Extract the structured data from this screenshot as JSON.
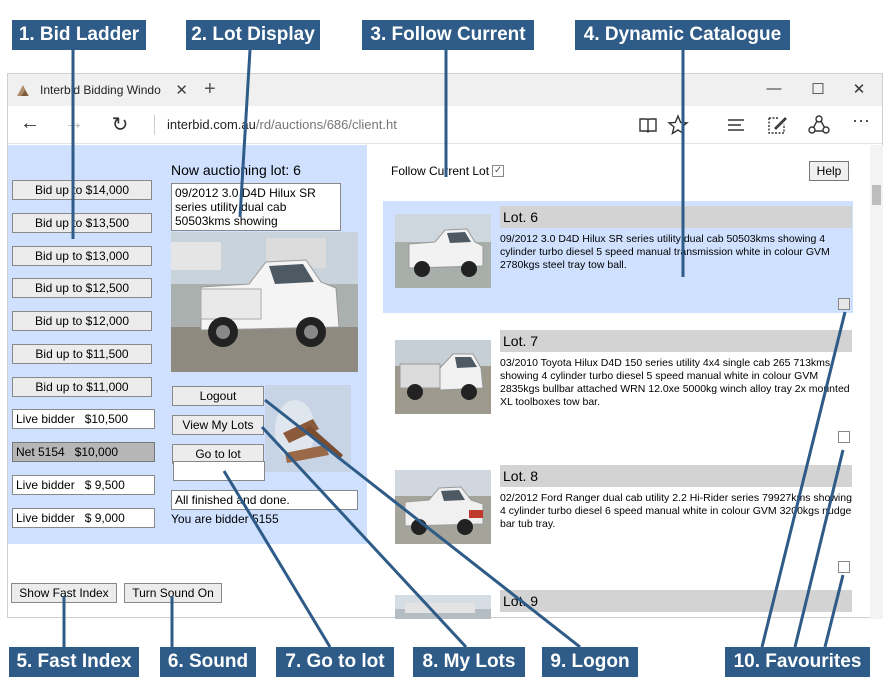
{
  "callouts": [
    {
      "label": "1. Bid Ladder"
    },
    {
      "label": "2. Lot Display"
    },
    {
      "label": "3. Follow Current"
    },
    {
      "label": "4. Dynamic Catalogue"
    },
    {
      "label": "5. Fast Index"
    },
    {
      "label": "6. Sound"
    },
    {
      "label": "7. Go to lot"
    },
    {
      "label": "8. My Lots"
    },
    {
      "label": "9. Logon"
    },
    {
      "label": "10. Favourites"
    }
  ],
  "browser": {
    "tab_title": "Interbid Bidding Windo",
    "tab_close": "✕",
    "new_tab": "+",
    "minimize": "—",
    "maximize": "☐",
    "close": "✕",
    "back": "←",
    "forward": "→",
    "refresh": "↻",
    "url_host": "interbid.com.au",
    "url_path": "/rd/auctions/686/client.ht",
    "more": "···"
  },
  "bid_ladder": {
    "buttons": [
      "Bid up to $14,000",
      "Bid up to $13,500",
      "Bid up to $13,000",
      "Bid up to $12,500",
      "Bid up to $12,000",
      "Bid up to $11,500",
      "Bid up to $11,000"
    ],
    "bids": [
      {
        "text": "Live bidder   $10,500",
        "net": false
      },
      {
        "text": "Net 5154   $10,000",
        "net": true
      },
      {
        "text": "Live bidder   $ 9,500",
        "net": false
      },
      {
        "text": "Live bidder   $ 9,000",
        "net": false
      }
    ]
  },
  "lot_display": {
    "now_auctioning": "Now auctioning lot: 6",
    "description": "09/2012 3.0 D4D Hilux SR series utility dual cab 50503kms showing",
    "logout": "Logout",
    "view_my_lots": "View My Lots",
    "go_to_lot": "Go to lot",
    "goto_value": "",
    "status": "All finished and done.",
    "bidder": "You are bidder 5155"
  },
  "bottom_buttons": {
    "fast_index": "Show Fast Index",
    "sound": "Turn Sound On"
  },
  "catalogue": {
    "follow_label": "Follow Current Lot",
    "follow_checked": true,
    "help": "Help",
    "lots": [
      {
        "title": "Lot. 6",
        "text": "09/2012 3.0 D4D Hilux SR series utility dual cab 50503kms showing 4 cylinder turbo diesel 5 speed manual transmission white in colour GVM 2780kgs steel tray tow ball.",
        "active": true
      },
      {
        "title": "Lot. 7",
        "text": "03/2010 Toyota Hilux D4D 150 series utility 4x4 single cab 265 713kms showing 4 cylinder turbo diesel 5 speed manual white in colour GVM 2835kgs bullbar attached WRN 12.0xe 5000kg winch alloy tray 2x mounted XL toolboxes tow bar.",
        "active": false
      },
      {
        "title": "Lot. 8",
        "text": "02/2012 Ford Ranger dual cab utility 2.2 Hi-Rider series 79927kms showing 4 cylinder turbo diesel 6 speed manual white in colour GVM 3200kgs nudge bar tub tray.",
        "active": false
      },
      {
        "title": "Lot. 9",
        "text": "",
        "active": false
      }
    ]
  },
  "colors": {
    "callout": "#2e5b87",
    "panel": "#cfe1ff",
    "lot_header": "#d3d3d3",
    "net_bid": "#b6b6b6"
  }
}
